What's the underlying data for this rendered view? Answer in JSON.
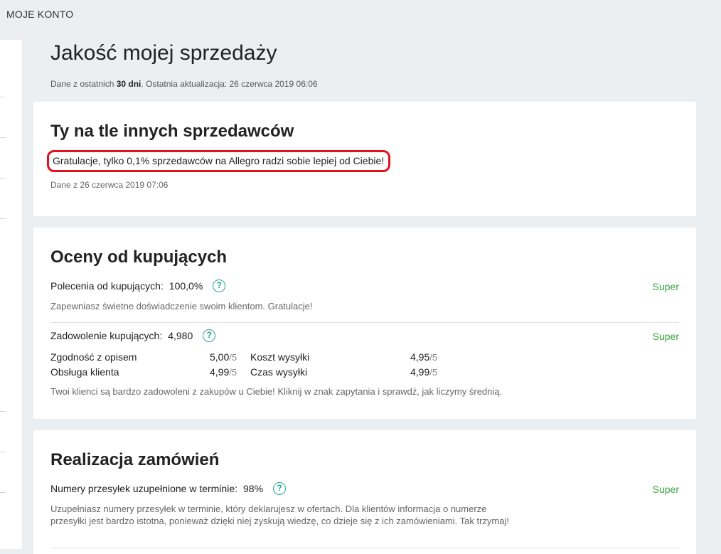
{
  "header": {
    "title": "MOJE KONTO"
  },
  "page": {
    "title": "Jakość mojej sprzedaży",
    "subtitle_prefix": "Dane z ostatnich ",
    "subtitle_days": "30 dni",
    "subtitle_suffix": ". Ostatnia aktualizacja: 26 czerwca 2019 06:06"
  },
  "comparison": {
    "title": "Ty na tle innych sprzedawców",
    "message": "Gratulacje, tylko 0,1% sprzedawców na Allegro radzi sobie lepiej od Ciebie!",
    "date": "Dane z 26 czerwca 2019 07:06"
  },
  "ratings": {
    "title": "Oceny od kupujących",
    "recommendations": {
      "label": "Polecenia od kupujących:",
      "value": "100,0%",
      "status": "Super",
      "description": "Zapewniasz świetne doświadczenie swoim klientom. Gratulacje!"
    },
    "satisfaction": {
      "label": "Zadowolenie kupujących:",
      "value": "4,980",
      "status": "Super",
      "description": "Twoi klienci są bardzo zadowoleni z zakupów u Ciebie! Kliknij w znak zapytania i sprawdź, jak liczymy średnią.",
      "denominator": "/5",
      "scores": [
        {
          "label": "Zgodność z opisem",
          "value": "5,00"
        },
        {
          "label": "Obsługa klienta",
          "value": "4,99"
        },
        {
          "label": "Koszt wysyłki",
          "value": "4,95"
        },
        {
          "label": "Czas wysyłki",
          "value": "4,99"
        }
      ]
    }
  },
  "fulfillment": {
    "title": "Realizacja zamówień",
    "tracking": {
      "label": "Numery przesyłek uzupełnione w terminie:",
      "value": "98%",
      "status": "Super",
      "description": "Uzupełniasz numery przesyłek w terminie, który deklarujesz w ofertach. Dla klientów informacja o numerze przesyłki jest bardzo istotna, ponieważ dzięki niej zyskują wiedzę, co dzieje się z ich zamówieniami. Tak trzymaj!"
    }
  },
  "icons": {
    "help": "question-mark-circle-icon"
  },
  "colors": {
    "accent": "#26a69a",
    "status_good": "#3aa43e",
    "highlight_border": "#e3111d"
  }
}
